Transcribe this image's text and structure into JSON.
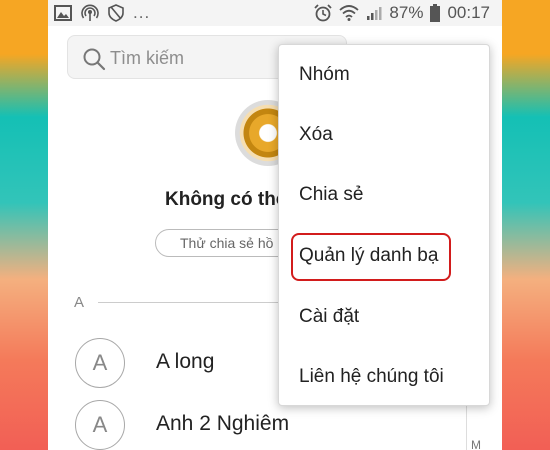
{
  "status_bar": {
    "left_icons": [
      "image-icon",
      "hotspot-icon",
      "shield-icon"
    ],
    "dots": "...",
    "right_icons": [
      "alarm-icon",
      "wifi-icon",
      "signal-icon",
      "battery-icon"
    ],
    "battery": "87%",
    "time": "00:17"
  },
  "search": {
    "placeholder": "Tìm kiếm"
  },
  "profile": {
    "title": "Không có thô",
    "share_label": "Thử chia sẻ hồ"
  },
  "contacts": {
    "section_letter": "A",
    "items": [
      {
        "initial": "A",
        "name": "A long"
      },
      {
        "initial": "A",
        "name": "Anh 2 Nghiêm"
      }
    ],
    "index_letter": "M"
  },
  "menu": {
    "items": [
      {
        "label": "Nhóm"
      },
      {
        "label": "Xóa"
      },
      {
        "label": "Chia sẻ"
      },
      {
        "label": "Quản lý danh bạ",
        "highlighted": true
      },
      {
        "label": "Cài đặt"
      },
      {
        "label": "Liên hệ chúng tôi"
      }
    ],
    "highlight_color": "#d21c1c"
  }
}
